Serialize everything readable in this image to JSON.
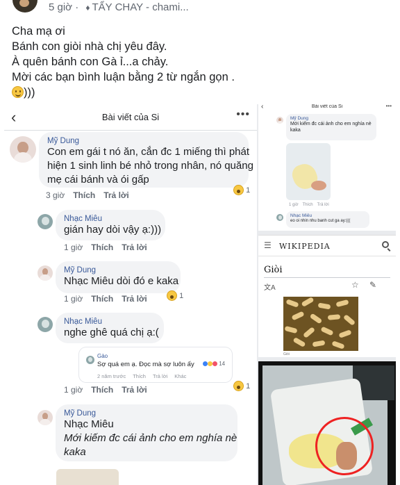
{
  "post": {
    "time": "5 giờ",
    "separator": "·",
    "tag_label": "TẨY CHAY - chami...",
    "lines": [
      "Cha mạ ơi",
      "Bánh con giòi nhà chị yêu đây.",
      "À quên bánh con Gà ỉ...a chảy.",
      "Mời các bạn bình luận bằng 2 từ ngắn gọn ."
    ],
    "last_line_suffix": ")))"
  },
  "screenshot": {
    "header_title": "Bài viết của Si",
    "back_icon": "chevron-left-icon",
    "more_icon": "more-horizontal-icon",
    "comments": [
      {
        "name": "Mỹ Dung",
        "lines": [
          "Con em gái t nó ăn, cắn đc 1 miếng thì phát",
          "hiện 1 sinh linh bé nhỏ trong nhân, nó quăng",
          "mẹ cái bánh và ói gấp"
        ],
        "time": "3 giờ",
        "like": "Thích",
        "reply": "Trả lời",
        "reaction_count": "1"
      },
      {
        "name": "Nhạc Miêu",
        "lines": [
          "gián hay dòi vậy ạ:)))"
        ],
        "time": "1 giờ",
        "like": "Thích",
        "reply": "Trả lời"
      },
      {
        "name": "Mỹ Dung",
        "mention": "Nhạc Miêu",
        "lines": [
          "dòi đó e kaka"
        ],
        "time": "1 giờ",
        "like": "Thích",
        "reply": "Trả lời",
        "reaction_count": "1"
      },
      {
        "name": "Nhạc Miêu",
        "lines": [
          "nghe ghê quá chị ạ:("
        ],
        "time": "1 giờ",
        "like": "Thích",
        "reply": "Trả lời",
        "reaction_count": "1"
      },
      {
        "name": "Mỹ Dung",
        "mention": "Nhạc Miêu",
        "lines": [
          "Mới kiếm đc cái ảnh cho em nghía nè",
          "kaka"
        ]
      }
    ],
    "quoted": {
      "name": "Gào",
      "message": "Sợ quá em ạ. Đọc mà sợ luôn ấy",
      "reaction_count": "14",
      "time": "2 năm trước",
      "like": "Thích",
      "reply": "Trả lời",
      "other": "Khác"
    }
  },
  "mini_screenshot": {
    "header_title": "Bài viết của Si",
    "c1_name": "Mỹ Dung",
    "c1_lines": [
      "Mới kiếm đc cái ảnh cho em nghía nè",
      "kaka"
    ],
    "c1_actions": [
      "1 giờ",
      "Thích",
      "Trả lời"
    ],
    "c2_name": "Nhạc Miêu",
    "c2_lines": [
      "eo oi nhin nhu banh cut ga ay:((("
    ]
  },
  "wikipedia": {
    "logo": "WIKIPEDIA",
    "article_title": "Giòi",
    "caption": "Giòi"
  }
}
